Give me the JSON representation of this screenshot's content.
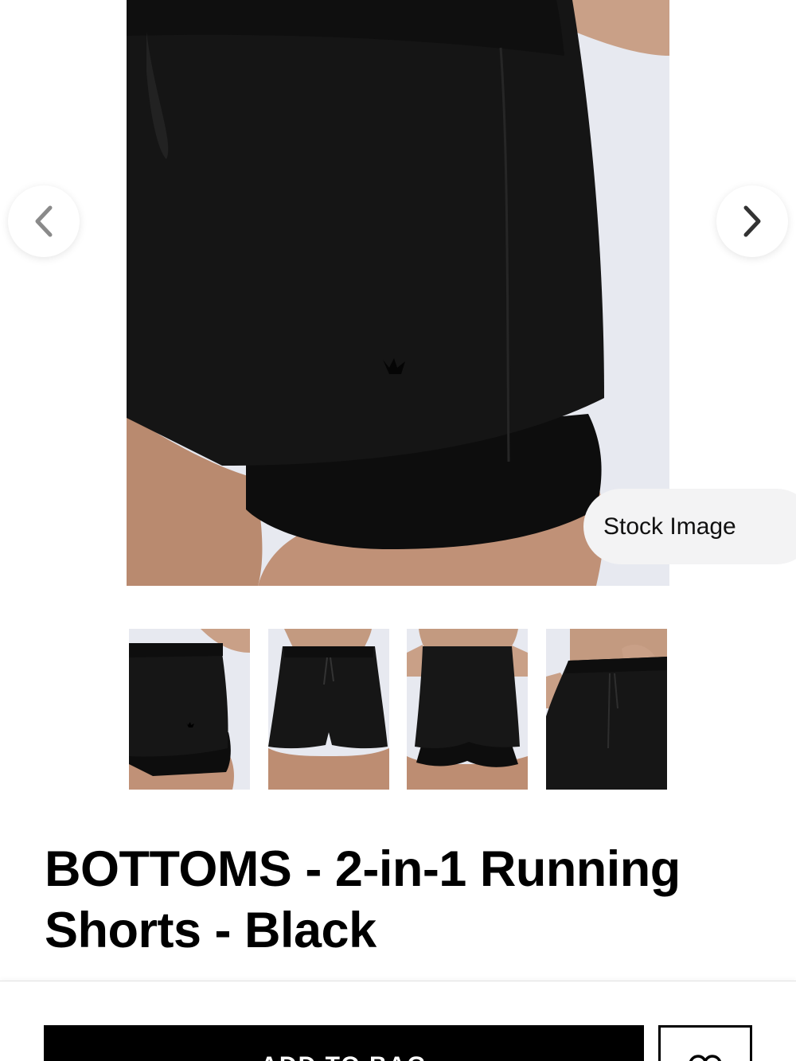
{
  "gallery": {
    "stock_label": "Stock Image",
    "prev_icon": "chevron-left-icon",
    "next_icon": "chevron-right-icon",
    "thumbnail_count": 4
  },
  "product": {
    "title": "BOTTOMS - 2-in-1 Running Shorts - Black"
  },
  "actions": {
    "add_to_bag_label": "ADD TO BAG",
    "wishlist_icon": "heart-icon"
  },
  "colors": {
    "photo_background": "#e6e8ef",
    "product_color": "#111111",
    "button_background": "#000000"
  }
}
